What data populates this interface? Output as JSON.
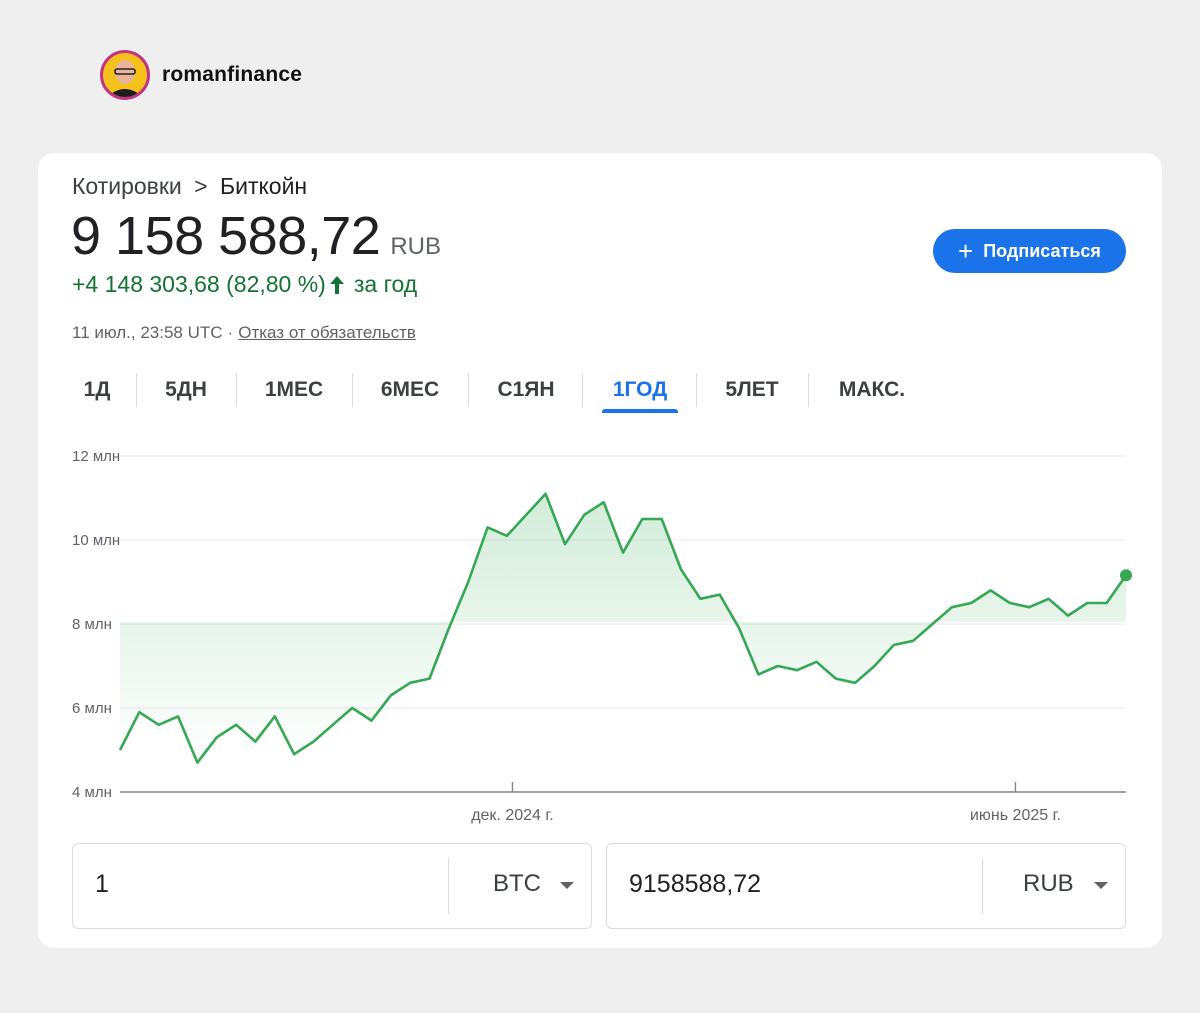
{
  "author": {
    "name": "romanfinance"
  },
  "header": {
    "breadcrumb_root": "Котировки",
    "breadcrumb_sep": ">",
    "breadcrumb_current": "Биткойн",
    "price": "9 158 588,72",
    "currency": "RUB",
    "change": "+4 148 303,68 (82,80 %)",
    "change_period": "за год",
    "timestamp": "11 июл., 23:58 UTC",
    "disclaimer": "Отказ от обязательств"
  },
  "subscribe": {
    "label": "Подписаться"
  },
  "tabs": [
    {
      "label": "1Д",
      "active": false
    },
    {
      "label": "5ДН",
      "active": false
    },
    {
      "label": "1МЕС",
      "active": false
    },
    {
      "label": "6МЕС",
      "active": false
    },
    {
      "label": "С1ЯН",
      "active": false
    },
    {
      "label": "1ГОД",
      "active": true
    },
    {
      "label": "5ЛЕТ",
      "active": false
    },
    {
      "label": "МАКС.",
      "active": false
    }
  ],
  "colors": {
    "accent": "#1a73e8",
    "positive": "#137333",
    "line": "#34a853"
  },
  "chart_data": {
    "type": "line",
    "title": "",
    "xlabel": "",
    "ylabel": "",
    "ylim": [
      4,
      12
    ],
    "y_ticks": [
      {
        "value": 12,
        "label": "12 млн"
      },
      {
        "value": 10,
        "label": "10 млн"
      },
      {
        "value": 8,
        "label": "8 млн"
      },
      {
        "value": 6,
        "label": "6 млн"
      },
      {
        "value": 4,
        "label": "4 млн"
      }
    ],
    "x_range": [
      "2024-07-12",
      "2025-07-11"
    ],
    "x_ticks": [
      {
        "date": "2024-12-01",
        "label": "дек. 2024 г."
      },
      {
        "date": "2025-06-01",
        "label": "июнь 2025 г."
      }
    ],
    "grid": true,
    "series": [
      {
        "unit": "млн RUB",
        "x": [
          "2024-07-12",
          "2024-07-19",
          "2024-07-26",
          "2024-08-02",
          "2024-08-09",
          "2024-08-16",
          "2024-08-23",
          "2024-08-30",
          "2024-09-06",
          "2024-09-13",
          "2024-09-20",
          "2024-09-27",
          "2024-10-04",
          "2024-10-11",
          "2024-10-18",
          "2024-10-25",
          "2024-11-01",
          "2024-11-08",
          "2024-11-15",
          "2024-11-22",
          "2024-11-29",
          "2024-12-06",
          "2024-12-13",
          "2024-12-20",
          "2024-12-27",
          "2025-01-03",
          "2025-01-10",
          "2025-01-17",
          "2025-01-24",
          "2025-01-31",
          "2025-02-07",
          "2025-02-14",
          "2025-02-21",
          "2025-02-28",
          "2025-03-07",
          "2025-03-14",
          "2025-03-21",
          "2025-03-28",
          "2025-04-04",
          "2025-04-11",
          "2025-04-18",
          "2025-04-25",
          "2025-05-02",
          "2025-05-09",
          "2025-05-16",
          "2025-05-23",
          "2025-05-30",
          "2025-06-06",
          "2025-06-13",
          "2025-06-20",
          "2025-06-27",
          "2025-07-04",
          "2025-07-11"
        ],
        "values": [
          5.0,
          5.9,
          5.6,
          5.8,
          4.7,
          5.3,
          5.6,
          5.2,
          5.8,
          4.9,
          5.2,
          5.6,
          6.0,
          5.7,
          6.3,
          6.6,
          6.7,
          7.9,
          9.0,
          10.3,
          10.1,
          10.6,
          11.1,
          9.9,
          10.6,
          10.9,
          9.7,
          10.5,
          10.5,
          9.3,
          8.6,
          8.7,
          7.9,
          6.8,
          7.0,
          6.9,
          7.1,
          6.7,
          6.6,
          7.0,
          7.5,
          7.6,
          8.0,
          8.4,
          8.5,
          8.8,
          8.5,
          8.4,
          8.6,
          8.2,
          8.5,
          8.5,
          9.16
        ]
      }
    ]
  },
  "converter": {
    "from_amount": "1",
    "from_currency": "BTC",
    "to_amount": "9158588,72",
    "to_currency": "RUB"
  }
}
